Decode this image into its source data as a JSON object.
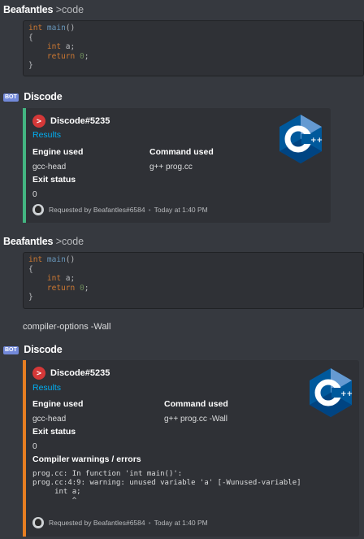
{
  "messages": [
    {
      "author": "Beafantles",
      "inline": ">code",
      "code": [
        "int main()",
        "{",
        "    int a;",
        "    return 0;",
        "}"
      ]
    },
    {
      "author": "Discode",
      "bot_tag": "BOT",
      "embed": {
        "author": "Discode#5235",
        "title": "Results",
        "engine_label": "Engine used",
        "engine_value": "gcc-head",
        "command_label": "Command used",
        "command_value": "g++ prog.cc",
        "exit_label": "Exit status",
        "exit_value": "0",
        "footer_user": "Requested by Beafantles#6584",
        "footer_time": "Today at 1:40 PM",
        "color": "#43b581"
      }
    },
    {
      "author": "Beafantles",
      "inline": ">code",
      "code": [
        "int main()",
        "{",
        "    int a;",
        "    return 0;",
        "}"
      ],
      "extra_text": "compiler-options -Wall"
    },
    {
      "author": "Discode",
      "bot_tag": "BOT",
      "embed": {
        "author": "Discode#5235",
        "title": "Results",
        "engine_label": "Engine used",
        "engine_value": "gcc-head",
        "command_label": "Command used",
        "command_value": "g++ prog.cc -Wall",
        "exit_label": "Exit status",
        "exit_value": "0",
        "warnings_label": "Compiler warnings / errors",
        "warnings_text": "prog.cc: In function 'int main()':\nprog.cc:4:9: warning: unused variable 'a' [-Wunused-variable]\n     int a;\n         ^",
        "footer_user": "Requested by Beafantles#6584",
        "footer_time": "Today at 1:40 PM",
        "color": "#e67e22"
      }
    }
  ],
  "icons": {
    "author_icon": "terminal-prompt-icon",
    "thumbnail": "cpp-logo-icon",
    "footer_avatar": "user-avatar-icon"
  },
  "footer_separator": "•"
}
